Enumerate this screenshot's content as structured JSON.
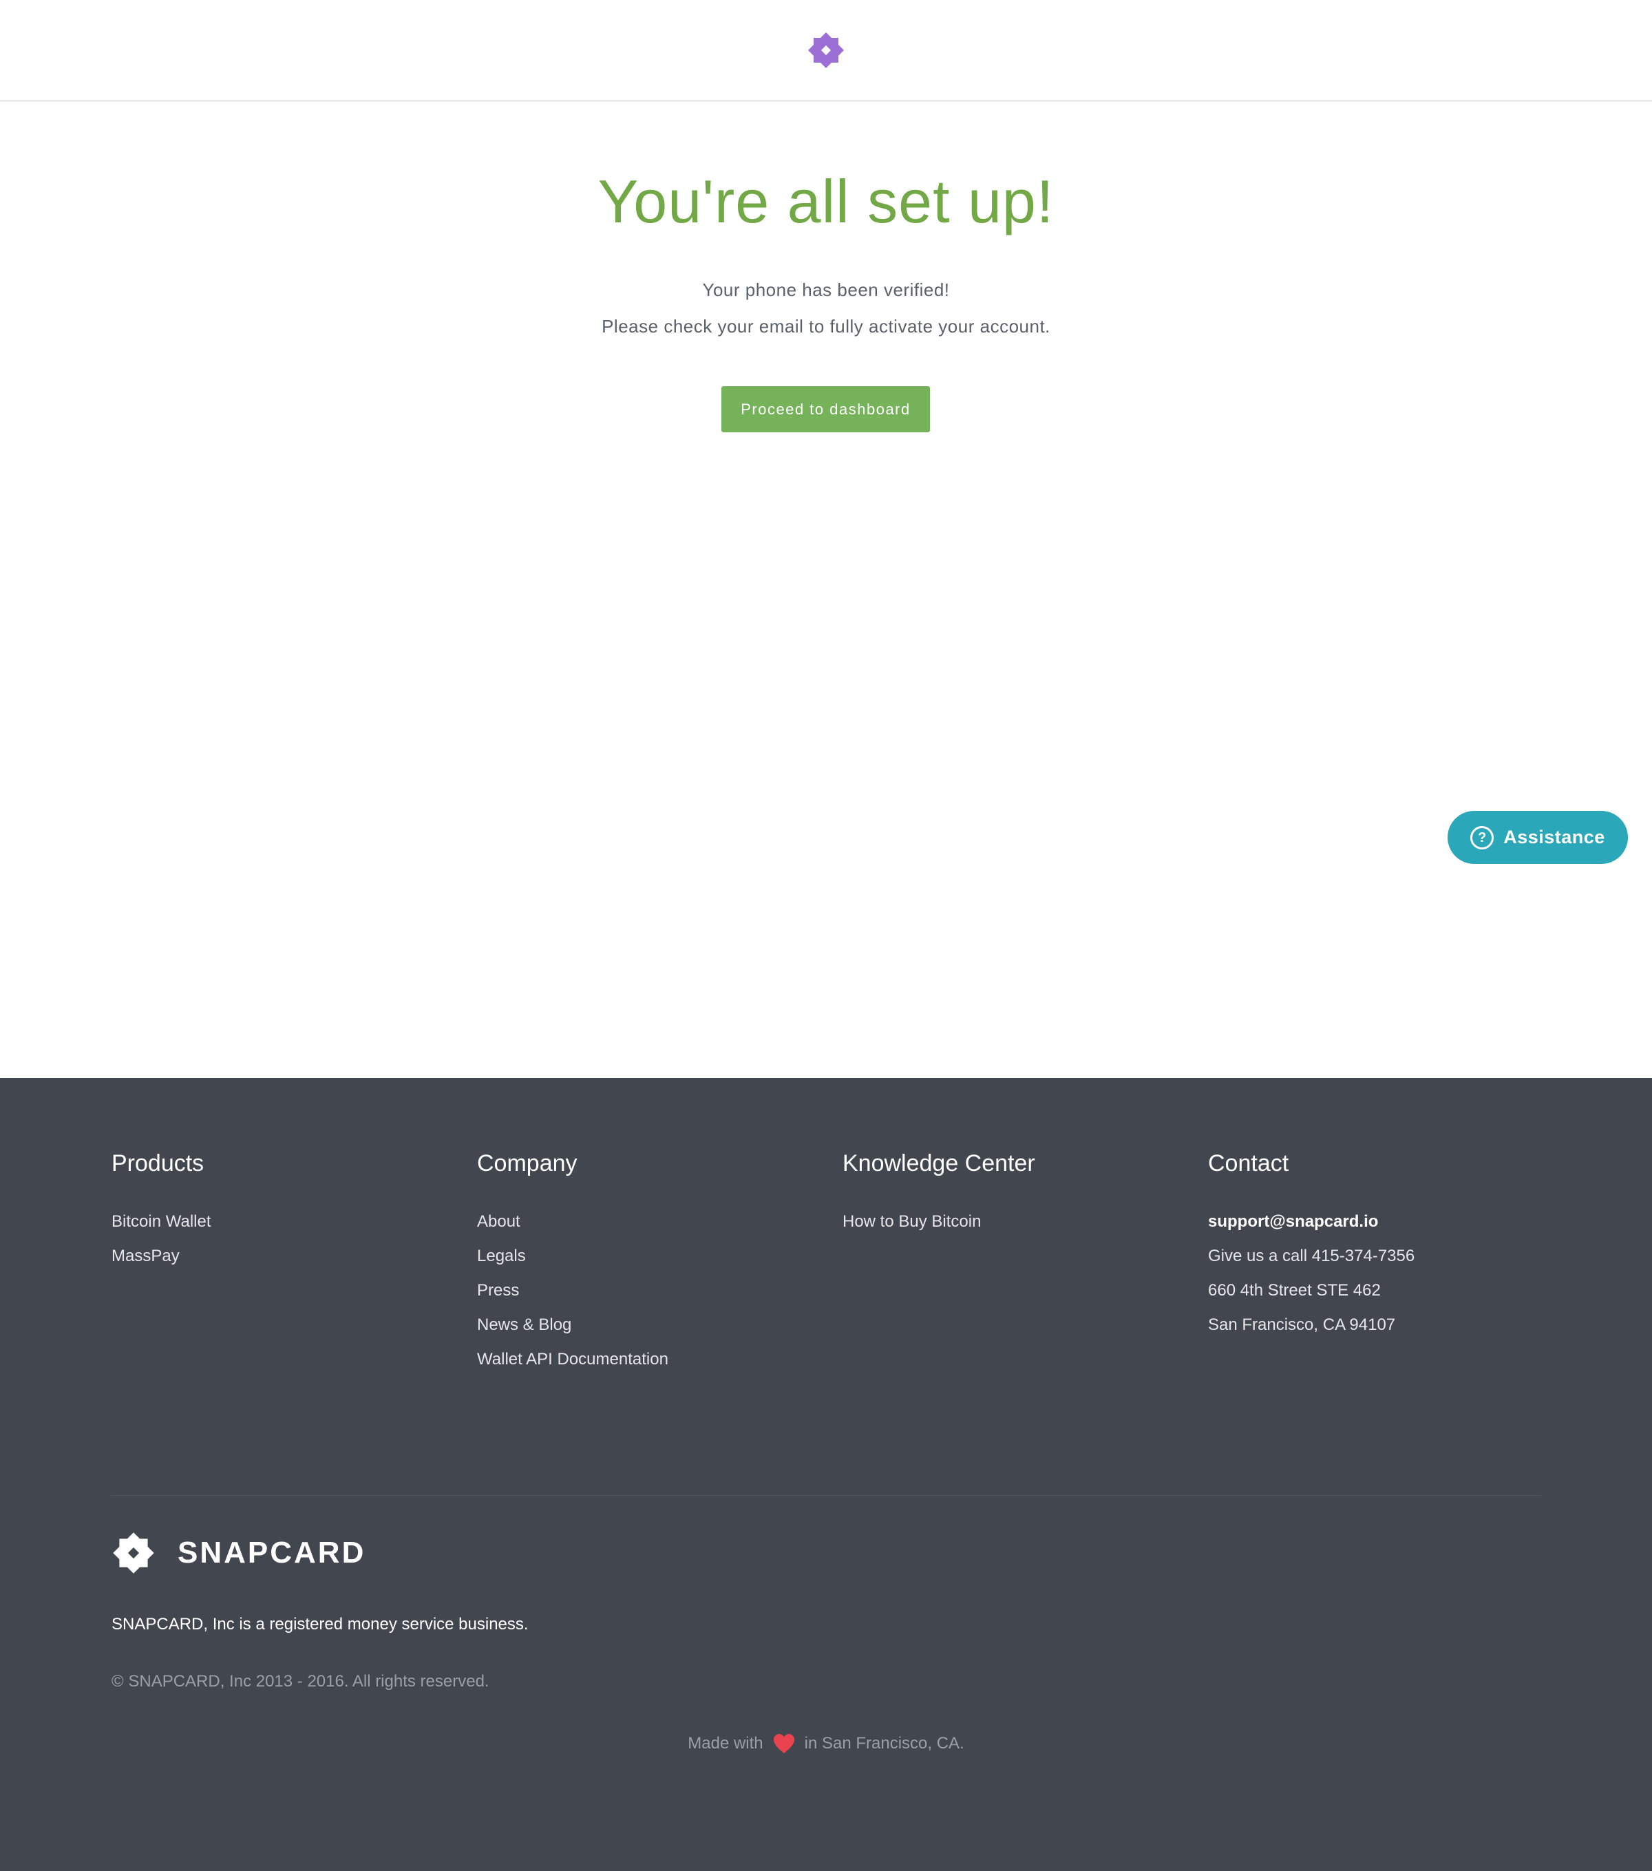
{
  "colors": {
    "accent_green": "#72a845",
    "button_green": "#76b25a",
    "logo_purple": "#9b6fd6",
    "assist_teal": "#2aa7b8",
    "footer_bg": "#42464f",
    "heart_red": "#e8434f"
  },
  "header": {
    "logo_icon": "snapcard-diamond-icon"
  },
  "main": {
    "title": "You're all set up!",
    "message_1": "Your phone has been verified!",
    "message_2": "Please check your email to fully activate your account.",
    "proceed_label": "Proceed to dashboard"
  },
  "assistance": {
    "icon": "question-circle-icon",
    "label": "Assistance"
  },
  "footer": {
    "products": {
      "heading": "Products",
      "items": [
        "Bitcoin Wallet",
        "MassPay"
      ]
    },
    "company": {
      "heading": "Company",
      "items": [
        "About",
        "Legals",
        "Press",
        "News & Blog",
        "Wallet API Documentation"
      ]
    },
    "knowledge": {
      "heading": "Knowledge Center",
      "items": [
        "How to Buy Bitcoin"
      ]
    },
    "contact": {
      "heading": "Contact",
      "email": "support@snapcard.io",
      "phone": "Give us a call 415-374-7356",
      "address_1": "660 4th Street STE 462",
      "address_2": "San Francisco, CA 94107"
    },
    "brand_name": "SNAPCARD",
    "registered": "SNAPCARD, Inc is a registered money service business.",
    "copyright": "© SNAPCARD, Inc 2013 - 2016. All rights reserved.",
    "made_with_prefix": "Made with",
    "made_with_suffix": "in San Francisco, CA."
  }
}
